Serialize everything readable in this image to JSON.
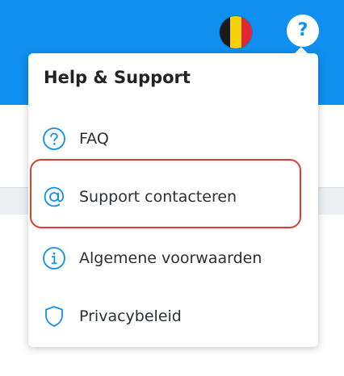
{
  "header": {
    "flag_icon": "belgium-flag-icon",
    "flag_colors": [
      "#1a1a1a",
      "#f7d20a",
      "#e3262f"
    ],
    "help_icon": "question-mark-icon",
    "help_glyph": "?",
    "accent": "#0f8fef"
  },
  "dropdown": {
    "title": "Help & Support",
    "items": [
      {
        "label": "FAQ",
        "icon": "question-circle-icon"
      },
      {
        "label": "Support contacteren",
        "icon": "at-sign-icon",
        "highlighted": true
      },
      {
        "label": "Algemene voorwaarden",
        "icon": "info-circle-icon"
      },
      {
        "label": "Privacybeleid",
        "icon": "shield-icon"
      }
    ],
    "highlight_color": "#dd3b30"
  }
}
